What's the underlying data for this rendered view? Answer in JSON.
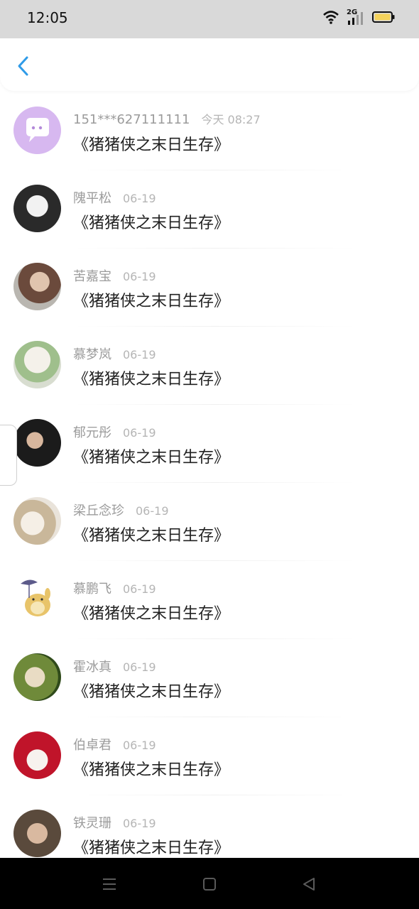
{
  "status_bar": {
    "time": "12:05",
    "network": "2G",
    "icons": [
      "wifi-icon",
      "signal-icon",
      "battery-icon"
    ]
  },
  "header": {
    "back_icon": "chevron-left-icon"
  },
  "messages": [
    {
      "name": "151***627111111",
      "time": "今天 08:27",
      "text": "《猪猪侠之末日生存》"
    },
    {
      "name": "隗平松",
      "time": "06-19",
      "text": "《猪猪侠之末日生存》"
    },
    {
      "name": "苦嘉宝",
      "time": "06-19",
      "text": "《猪猪侠之末日生存》"
    },
    {
      "name": "慕梦岚",
      "time": "06-19",
      "text": "《猪猪侠之末日生存》"
    },
    {
      "name": "郁元彤",
      "time": "06-19",
      "text": "《猪猪侠之末日生存》"
    },
    {
      "name": "梁丘念珍",
      "time": "06-19",
      "text": "《猪猪侠之末日生存》"
    },
    {
      "name": "慕鹏飞",
      "time": "06-19",
      "text": "《猪猪侠之末日生存》"
    },
    {
      "name": "霍冰真",
      "time": "06-19",
      "text": "《猪猪侠之末日生存》"
    },
    {
      "name": "伯卓君",
      "time": "06-19",
      "text": "《猪猪侠之末日生存》"
    },
    {
      "name": "铁灵珊",
      "time": "06-19",
      "text": "《猪猪侠之末日生存》"
    }
  ],
  "colors": {
    "accent": "#2f9be8",
    "status_bar_bg": "#d9d9d9",
    "battery": "#f5d35c"
  },
  "navigation": [
    "menu-icon",
    "home-icon",
    "back-triangle-icon"
  ]
}
